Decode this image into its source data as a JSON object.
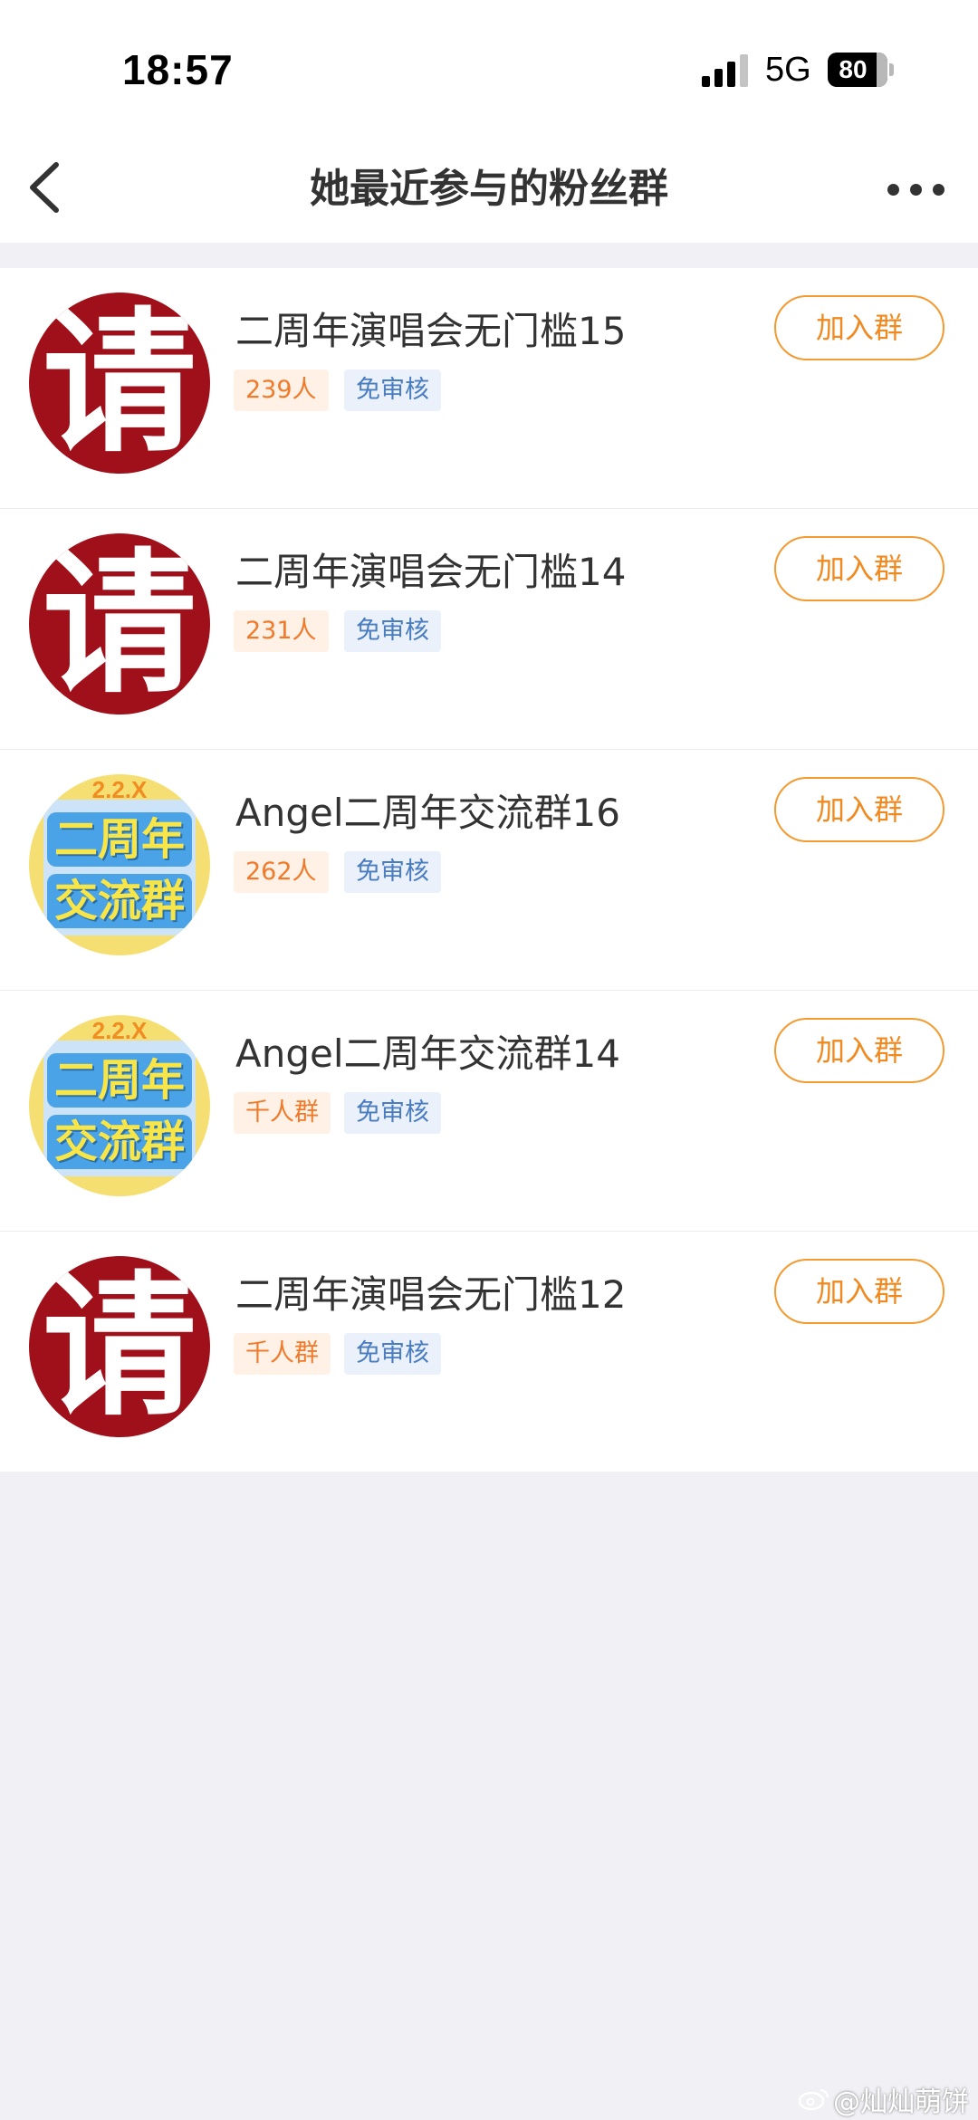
{
  "status_bar": {
    "time": "18:57",
    "network": "5G",
    "battery": "80",
    "signal_icon": "cellular-signal-icon",
    "battery_icon": "battery-icon"
  },
  "header": {
    "title": "她最近参与的粉丝群",
    "back_icon": "back-chevron-icon",
    "more_icon": "more-dots-icon"
  },
  "groups": [
    {
      "name": "二周年演唱会无门槛15",
      "count": "239人",
      "review": "免审核",
      "join_label": "加入群",
      "avatar_char": "请"
    },
    {
      "name": "二周年演唱会无门槛14",
      "count": "231人",
      "review": "免审核",
      "join_label": "加入群",
      "avatar_char": "请"
    },
    {
      "name": "Angel二周年交流群16",
      "count": "262人",
      "review": "免审核",
      "join_label": "加入群",
      "avatar_top": "2.2.X",
      "avatar_line1": "二周年",
      "avatar_line2": "交流群"
    },
    {
      "name": "Angel二周年交流群14",
      "count": "千人群",
      "review": "免审核",
      "join_label": "加入群",
      "avatar_top": "2.2.X",
      "avatar_line1": "二周年",
      "avatar_line2": "交流群"
    },
    {
      "name": "二周年演唱会无门槛12",
      "count": "千人群",
      "review": "免审核",
      "join_label": "加入群",
      "avatar_char": "请"
    }
  ],
  "watermark": "@灿灿萌饼",
  "colors": {
    "accent": "#f08a20",
    "count_tag_text": "#f07a2a",
    "free_tag_text": "#4a7cc0",
    "avatar_red": "#a0101a",
    "background": "#f0f0f5"
  }
}
